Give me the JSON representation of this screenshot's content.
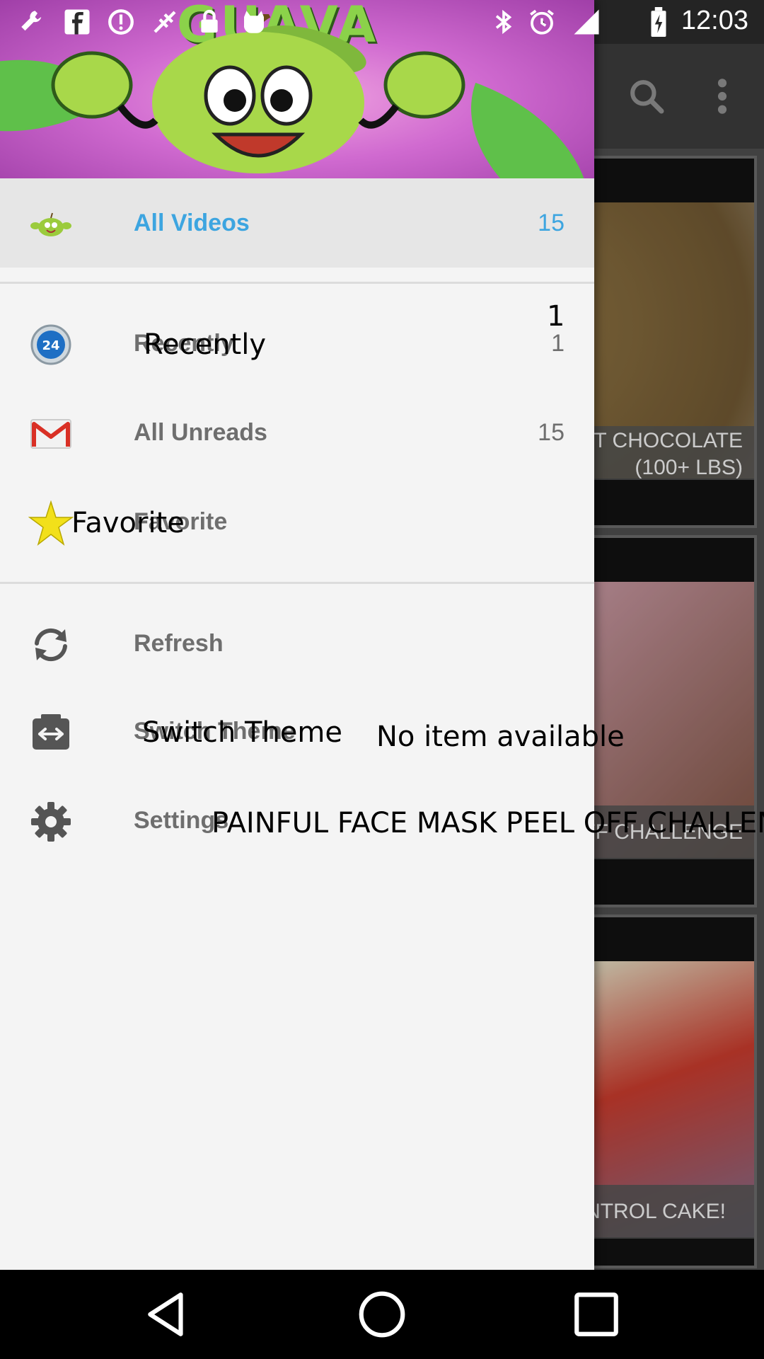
{
  "status_bar": {
    "time": "12:03"
  },
  "header": {
    "brand_text": "GUAVA"
  },
  "drawer": {
    "items": [
      {
        "label": "All Videos",
        "count": "15",
        "icon": "guava-icon"
      },
      {
        "label": "Recently",
        "count": "1",
        "icon": "24-hours-icon"
      },
      {
        "label": "All Unreads",
        "count": "15",
        "icon": "gmail-icon"
      },
      {
        "label": "Favorite",
        "count": "",
        "icon": "star-icon"
      }
    ],
    "actions": [
      {
        "label": "Refresh",
        "icon": "refresh-icon"
      },
      {
        "label": "Switch Theme",
        "icon": "switch-theme-icon"
      },
      {
        "label": "Settings",
        "icon": "settings-icon"
      }
    ]
  },
  "overlays": {
    "recently_count": "1",
    "recently_label": "Recently",
    "favorite_label": "Favorite",
    "switch_theme_label": "Switch Theme",
    "empty_message": "No item available",
    "painful_title": "PAINFUL FACE MASK PEEL OFF CHALLENGE"
  },
  "background": {
    "cards": [
      {
        "caption_line1": "GIANT CHOCOLATE",
        "caption_line2": "(100+ LBS)"
      },
      {
        "caption": "PEEL OFF CHALLENGE"
      },
      {
        "caption": "CONTROL CAKE!"
      }
    ]
  },
  "colors": {
    "accent": "#3da5e0",
    "drawer_bg": "#f4f4f4",
    "selected_bg": "#e6e6e6"
  }
}
